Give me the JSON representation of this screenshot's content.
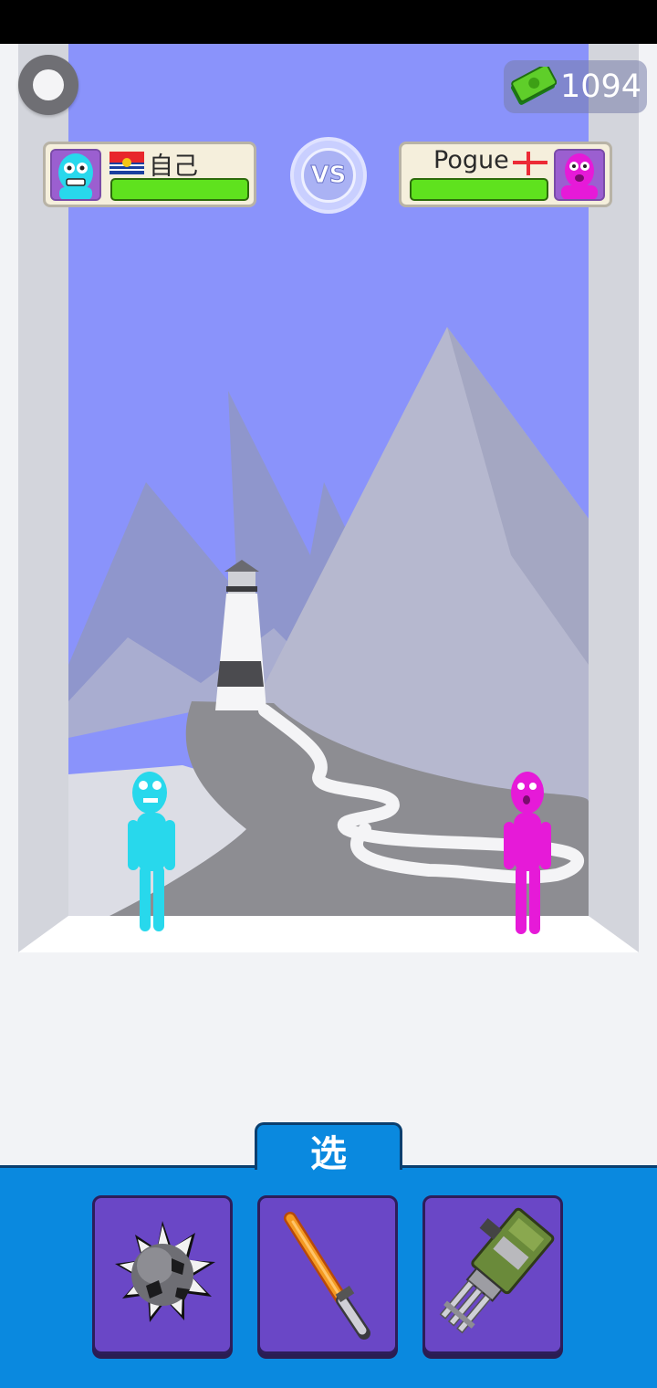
{
  "hud": {
    "money": "1094",
    "vs_label": "VS"
  },
  "player": {
    "name": "自己",
    "health_fraction": 1.0,
    "color": "#28d8ec"
  },
  "opponent": {
    "name": "Pogue",
    "health_fraction": 1.0,
    "color": "#e61ad8"
  },
  "selection": {
    "tab_label": "选",
    "weapons": [
      {
        "name": "spiked-ball-icon"
      },
      {
        "name": "lightsaber-icon"
      },
      {
        "name": "minigun-icon"
      }
    ]
  },
  "colors": {
    "sky": "#8a93fb",
    "panel": "#0a89df",
    "weapon_slot": "#6a47c6",
    "health": "#5fe21e"
  }
}
